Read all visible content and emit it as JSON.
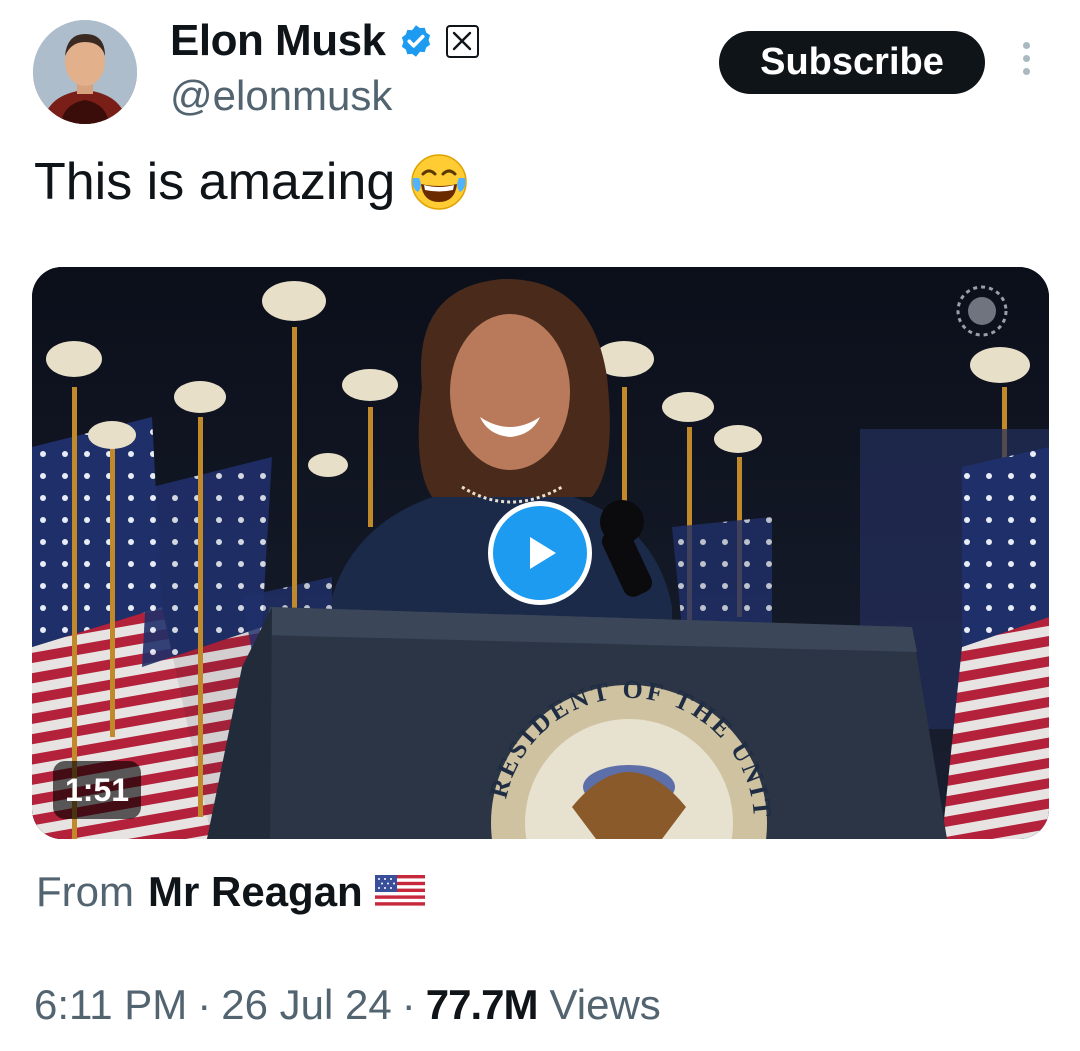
{
  "author": {
    "name": "Elon Musk",
    "handle": "@elonmusk",
    "verified_icon": "verified-badge-icon",
    "affiliate_icon": "x-logo-icon"
  },
  "header": {
    "subscribe_label": "Subscribe",
    "more_icon": "more-vertical-icon"
  },
  "tweet": {
    "text": "This is amazing",
    "emoji": "face-with-tears-of-joy-icon"
  },
  "media": {
    "duration": "1:51",
    "play_icon": "play-icon",
    "seal_text": "RESIDENT OF THE UNITED S"
  },
  "attribution": {
    "from_label": "From",
    "source_name": "Mr Reagan",
    "flag_icon": "us-flag-icon"
  },
  "meta": {
    "time": "6:11 PM",
    "date": "26 Jul 24",
    "views_count": "77.7M",
    "views_label": "Views"
  },
  "colors": {
    "accent": "#1d9bf0",
    "text": "#0f1419",
    "secondary": "#536471"
  }
}
